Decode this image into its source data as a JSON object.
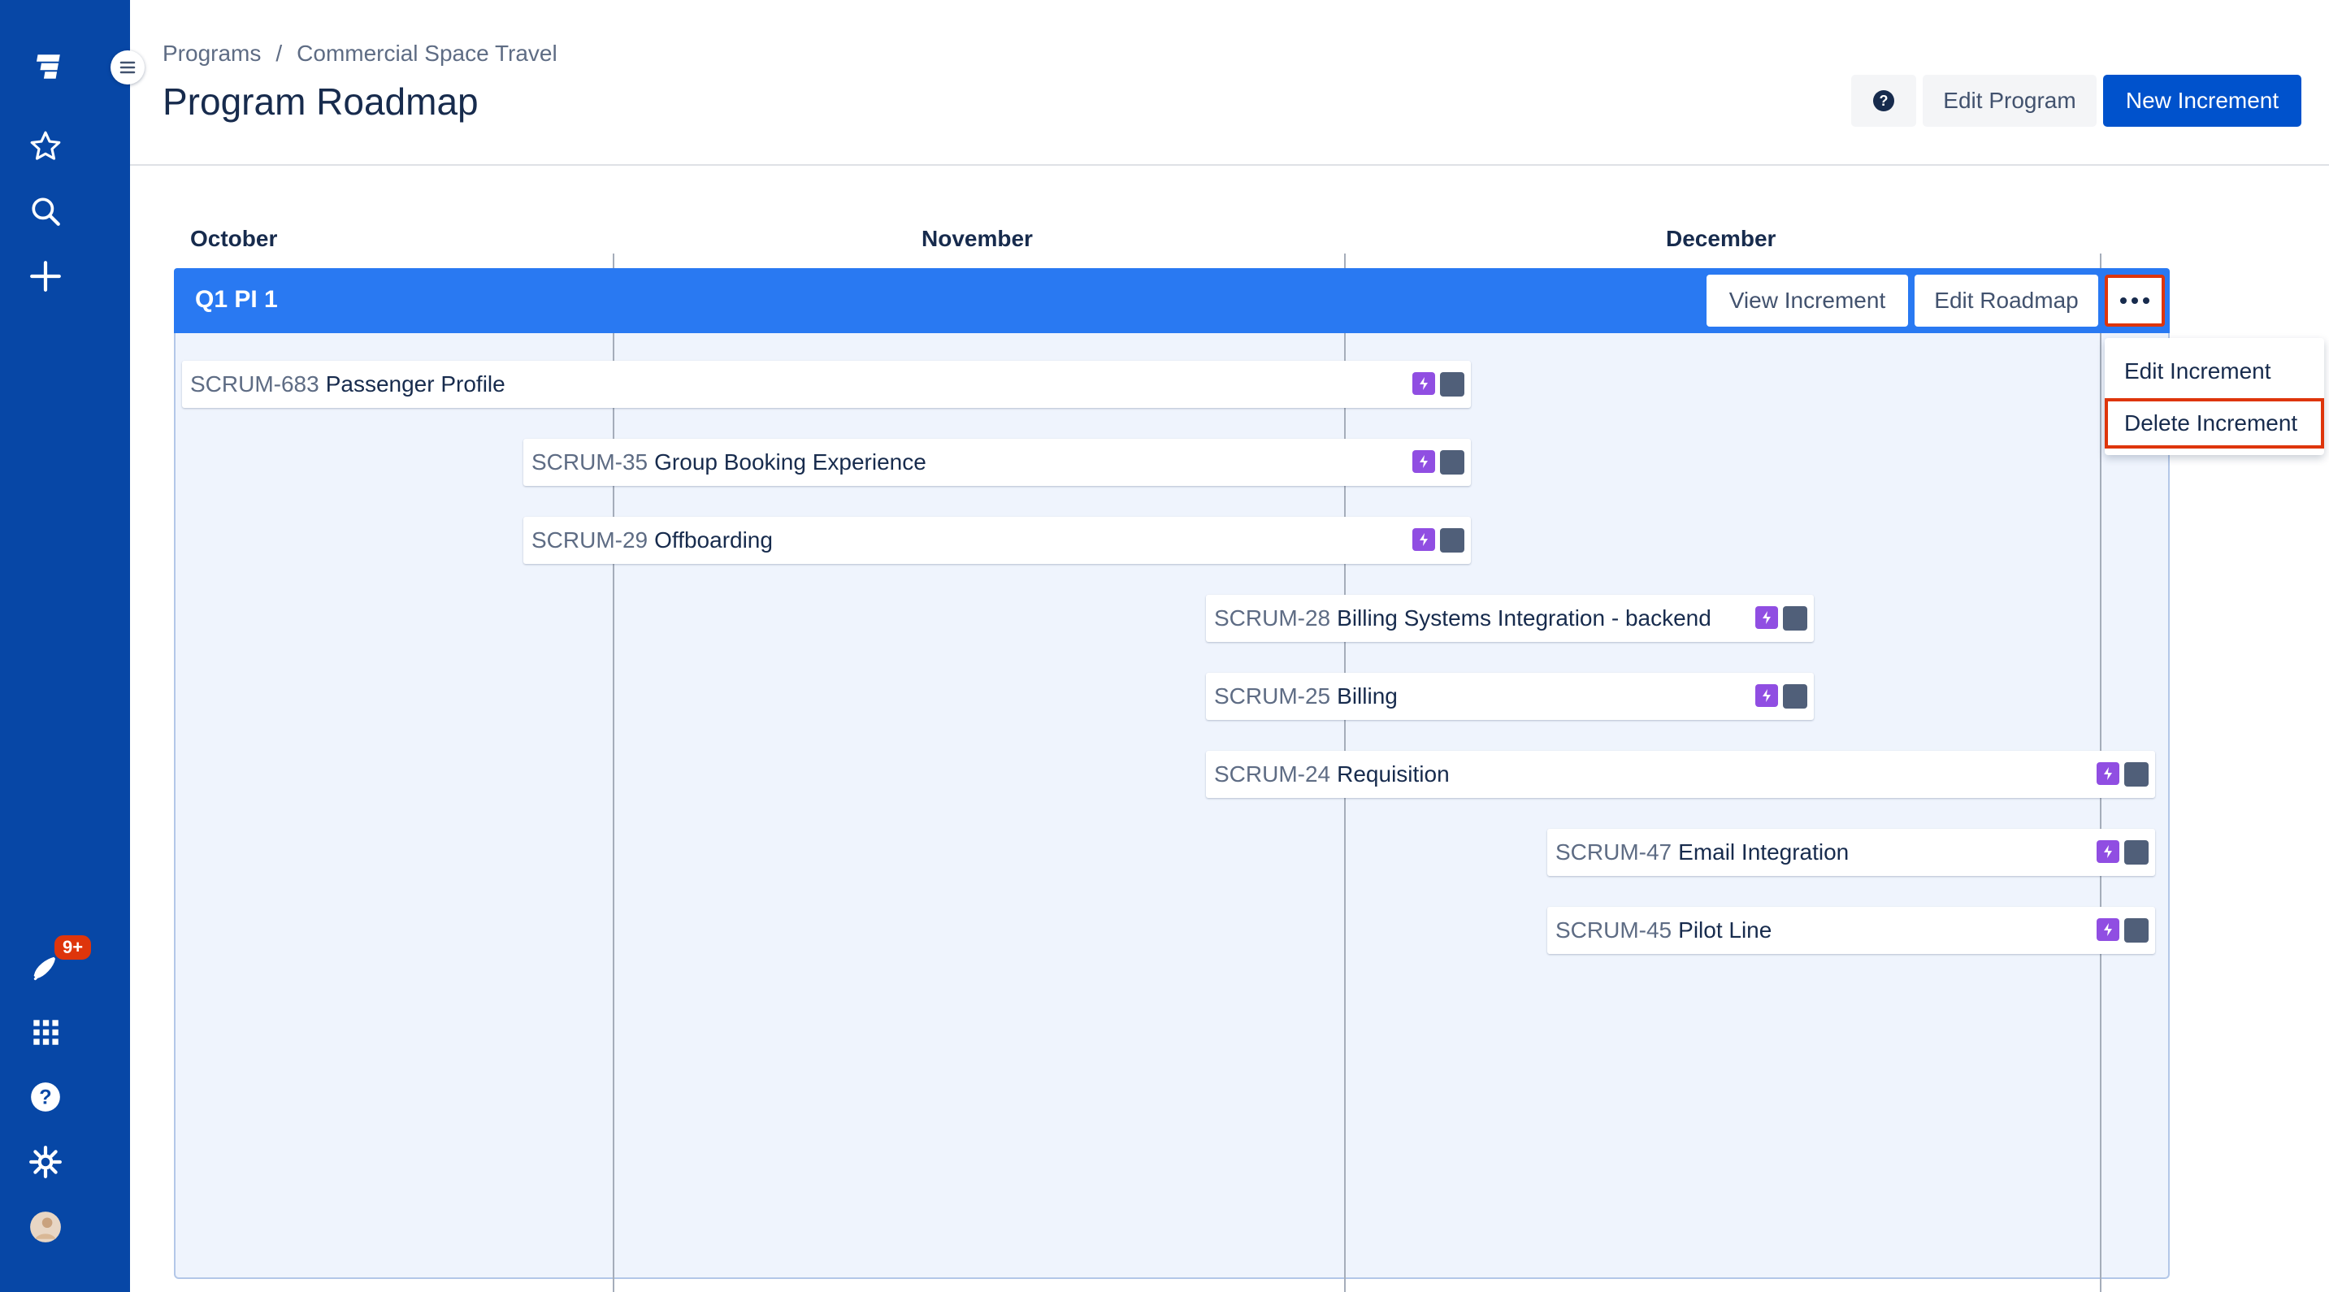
{
  "nav": {
    "notification_count": "9+"
  },
  "breadcrumb": {
    "items": [
      "Programs",
      "Commercial Space Travel"
    ],
    "separator": "/"
  },
  "header": {
    "title": "Program Roadmap",
    "help_icon": "question-circle-icon",
    "edit_program_label": "Edit Program",
    "new_increment_label": "New Increment"
  },
  "timeline": {
    "months": [
      "October",
      "November",
      "December"
    ]
  },
  "increment": {
    "name": "Q1 PI 1",
    "view_label": "View Increment",
    "edit_roadmap_label": "Edit Roadmap",
    "more_label": "•••",
    "menu": [
      "Edit Increment",
      "Delete Increment"
    ]
  },
  "issues": [
    {
      "key": "SCRUM-683",
      "title": "Passenger Profile"
    },
    {
      "key": "SCRUM-35",
      "title": "Group Booking Experience"
    },
    {
      "key": "SCRUM-29",
      "title": "Offboarding"
    },
    {
      "key": "SCRUM-28",
      "title": "Billing Systems Integration - backend"
    },
    {
      "key": "SCRUM-25",
      "title": "Billing"
    },
    {
      "key": "SCRUM-24",
      "title": "Requisition"
    },
    {
      "key": "SCRUM-47",
      "title": "Email Integration"
    },
    {
      "key": "SCRUM-45",
      "title": "Pilot Line"
    }
  ],
  "colors": {
    "nav_bg": "#0747a6",
    "primary": "#0052cc",
    "increment_bar": "#2979f2",
    "epic": "#904ee2",
    "highlight": "#de350b"
  }
}
